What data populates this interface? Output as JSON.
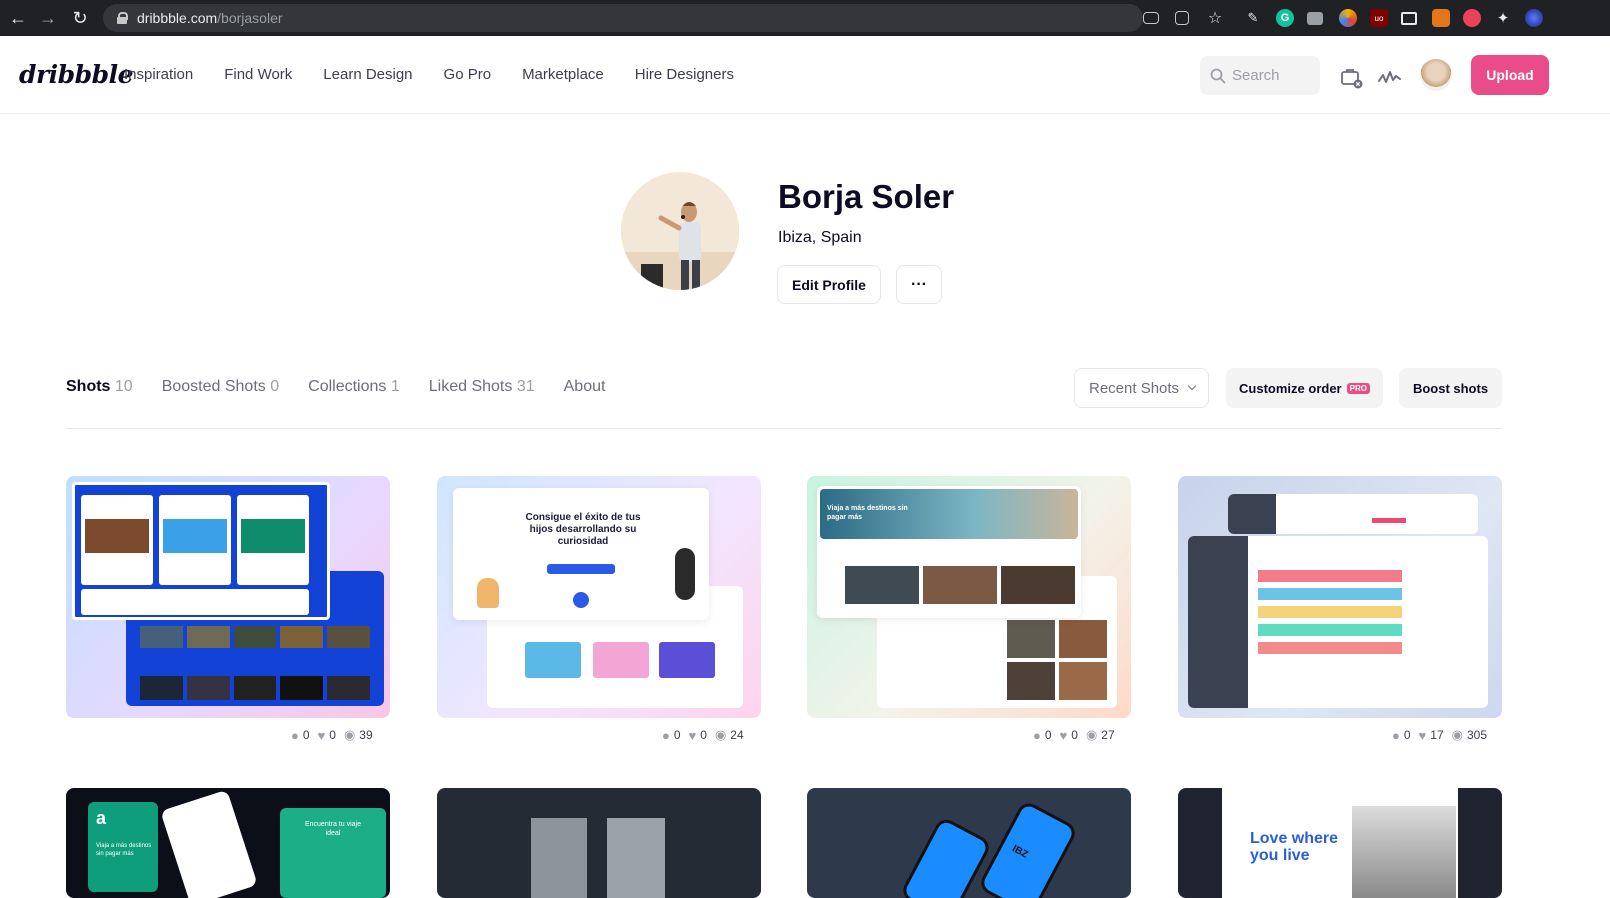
{
  "browser": {
    "url_host": "dribbble.com",
    "url_path": "/borjasoler"
  },
  "header": {
    "logo": "dribbble",
    "nav": [
      "Inspiration",
      "Find Work",
      "Learn Design",
      "Go Pro",
      "Marketplace",
      "Hire Designers"
    ],
    "search_placeholder": "Search",
    "upload_label": "Upload"
  },
  "profile": {
    "name": "Borja Soler",
    "location": "Ibiza, Spain",
    "edit_label": "Edit Profile",
    "more_label": "···"
  },
  "tabs": [
    {
      "label": "Shots",
      "count": "10"
    },
    {
      "label": "Boosted Shots",
      "count": "0"
    },
    {
      "label": "Collections",
      "count": "1"
    },
    {
      "label": "Liked Shots",
      "count": "31"
    },
    {
      "label": "About",
      "count": ""
    }
  ],
  "toolbar": {
    "sort_label": "Recent Shots",
    "customize_label": "Customize order",
    "pro_badge": "PRO",
    "boost_label": "Boost shots"
  },
  "shots": [
    {
      "comments": "0",
      "likes": "0",
      "views": "39",
      "text": ""
    },
    {
      "comments": "0",
      "likes": "0",
      "views": "24",
      "text": "Consigue el éxito de tus hijos desarrollando su curiosidad"
    },
    {
      "comments": "0",
      "likes": "0",
      "views": "27",
      "text": "Viaja a más destinos sin pagar más"
    },
    {
      "comments": "0",
      "likes": "17",
      "views": "305",
      "text": ""
    },
    {
      "text": "Encuentra tu viaje ideal",
      "text2": "Viaja a más destinos sin pagar más"
    },
    {
      "text": ""
    },
    {
      "text": "IBZ"
    },
    {
      "text": "Love where you live"
    }
  ],
  "colors": {
    "brand_pink": "#ea4c89",
    "text_dark": "#0d0c22",
    "text_muted": "#6e6d7a"
  }
}
